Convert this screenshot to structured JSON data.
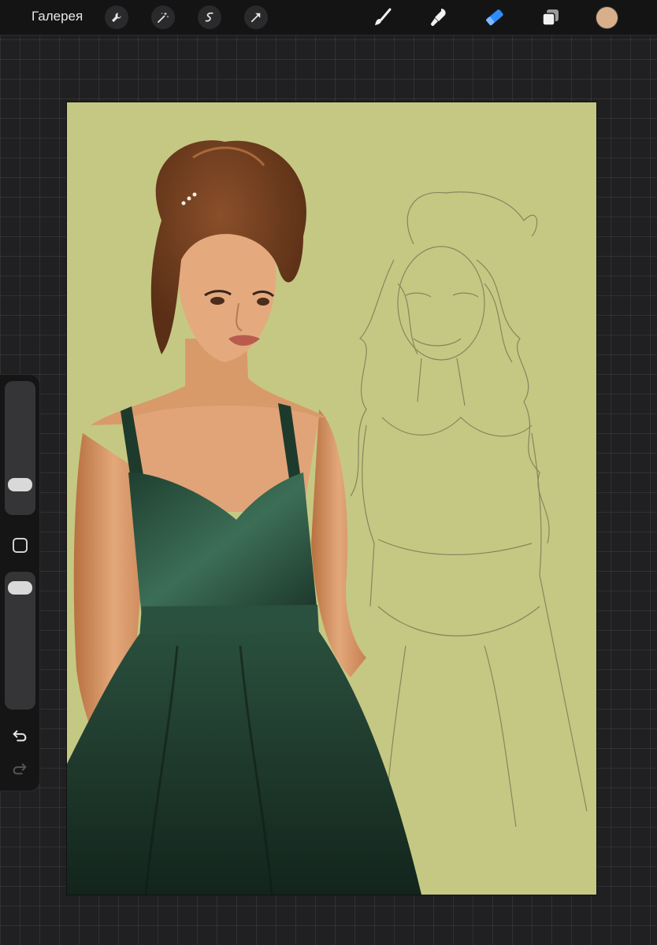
{
  "toolbar": {
    "gallery_label": "Галерея",
    "left_icons": [
      "wrench-icon",
      "magic-wand-icon",
      "selection-icon",
      "transform-arrow-icon"
    ],
    "right_tools": [
      "brush-icon",
      "smudge-icon",
      "eraser-icon",
      "layers-icon"
    ],
    "active_tool": "eraser",
    "active_color": "#d9ae8b",
    "accent_color": "#2e8cff"
  },
  "canvas": {
    "background_color": "#c5c883",
    "subject": "illustration"
  },
  "sidebar": {
    "brush_size_level": 0.18,
    "opacity_level": 0.95,
    "buttons": [
      "modify-square-icon",
      "undo-icon",
      "redo-icon"
    ],
    "redo_enabled": false
  }
}
